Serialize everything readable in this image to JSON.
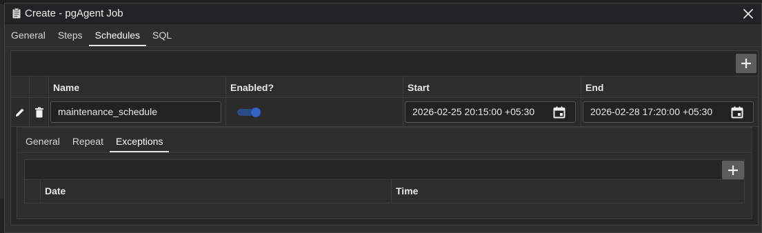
{
  "window": {
    "title": "Create - pgAgent Job"
  },
  "main_tabs": [
    {
      "label": "General",
      "active": false
    },
    {
      "label": "Steps",
      "active": false
    },
    {
      "label": "Schedules",
      "active": true
    },
    {
      "label": "SQL",
      "active": false
    }
  ],
  "schedules": {
    "columns": {
      "name": "Name",
      "enabled": "Enabled?",
      "start": "Start",
      "end": "End"
    },
    "rows": [
      {
        "name": "maintenance_schedule",
        "enabled": true,
        "start": "2026-02-25 20:15:00 +05:30",
        "end": "2026-02-28 17:20:00 +05:30"
      }
    ]
  },
  "schedule_tabs": [
    {
      "label": "General",
      "active": false
    },
    {
      "label": "Repeat",
      "active": false
    },
    {
      "label": "Exceptions",
      "active": true
    }
  ],
  "exceptions": {
    "columns": {
      "date": "Date",
      "time": "Time"
    }
  },
  "icons": {
    "title": "clipboard-icon",
    "close": "close-icon",
    "add": "plus-icon",
    "edit": "pencil-icon",
    "delete": "trash-icon",
    "calendar": "calendar-icon"
  },
  "colors": {
    "toggle": "#1f4fa0",
    "accent": "#e6e6e6"
  }
}
